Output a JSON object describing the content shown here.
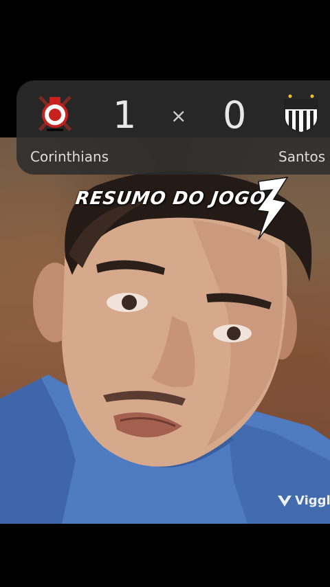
{
  "scoreboard": {
    "home_team": "Corinthians",
    "away_team": "Santos",
    "home_score": "1",
    "away_score": "0",
    "separator": "×",
    "home_crest_icon": "corinthians-crest-icon",
    "away_crest_icon": "santos-crest-icon"
  },
  "overlay": {
    "title": "RESUMO DO JOGO",
    "brand_icon": "lightning-3-logo-icon"
  },
  "watermark": {
    "text": "Viggle",
    "icon": "viggle-v-icon"
  },
  "colors": {
    "page_background": "#000000",
    "scoreboard_background": "#2c2c2c",
    "score_text": "#e8e8e8",
    "overlay_text": "#ffffff",
    "shirt": "#4f7bc0",
    "wall": "#7e6248"
  }
}
